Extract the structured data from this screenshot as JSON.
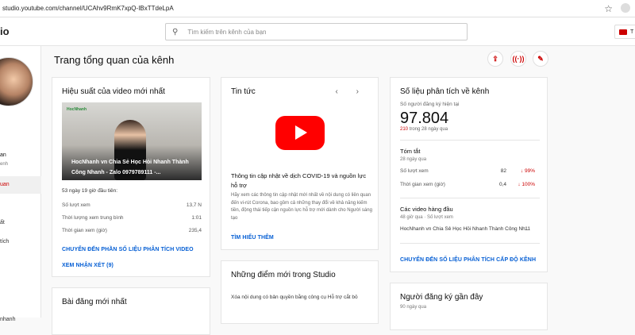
{
  "browser": {
    "url": "studio.youtube.com/channel/UCAhv9RmK7xpQ-IBxTTdeLpA"
  },
  "topbar": {
    "logo": "io",
    "search_placeholder": "Tìm kiếm trên kênh của bạn",
    "create_label": "T"
  },
  "sidebar": {
    "channel_name": "an",
    "channel_sub": "enh",
    "items": [
      {
        "label": "uan"
      },
      {
        "label": "ất"
      },
      {
        "label": "tích"
      },
      {
        "label": "nhanh"
      }
    ]
  },
  "page": {
    "title": "Trang tổng quan của kênh"
  },
  "latest_video": {
    "title": "Hiệu suất của video mới nhất",
    "thumb_brand": "HocNhanh",
    "thumb_caption": "HocNhanh vn Chia Sẻ Học Hỏi Nhanh Thành Công Nhanh - Zalo 0979789111 -...",
    "period": "53 ngày 19 giờ đầu tiên:",
    "stats": [
      {
        "label": "Số lượt xem",
        "value": "13,7 N"
      },
      {
        "label": "Thời lượng xem trung bình",
        "value": "1:01"
      },
      {
        "label": "Thời gian xem (giờ)",
        "value": "235,4"
      }
    ],
    "link_analytics": "CHUYỂN ĐẾN PHẦN SỐ LIỆU PHÂN TÍCH VIDEO",
    "link_comments": "XEM NHẬN XÉT (9)"
  },
  "latest_post": {
    "title": "Bài đăng mới nhất"
  },
  "news": {
    "title": "Tin tức",
    "headline": "Thông tin cập nhật về dịch COVID-19 và nguồn lực hỗ trợ",
    "body": "Hãy xem các thông tin cập nhật mới nhất về nội dung có liên quan đến vi-rút Corona, bao gồm cả những thay đổi về khả năng kiếm tiền, động thái tiếp cận nguồn lực hỗ trợ mới dành cho Người sáng tạo",
    "link": "TÌM HIỂU THÊM",
    "arrows": "‹ ›"
  },
  "whats_new": {
    "title": "Những điểm mới trong Studio",
    "item": "Xóa nội dung có bản quyền bằng công cụ Hỗ trợ cắt bỏ"
  },
  "analytics": {
    "title": "Số liệu phân tích về kênh",
    "subs_label": "Số người đăng ký hiện tại",
    "subs_value": "97.804",
    "subs_change": "210",
    "subs_change_suffix": "trong 28 ngày qua",
    "summary_title": "Tóm tắt",
    "summary_period": "28 ngày qua",
    "metrics": [
      {
        "label": "Số lượt xem",
        "value": "82",
        "delta": "99%"
      },
      {
        "label": "Thời gian xem (giờ)",
        "value": "0,4",
        "delta": "100%"
      }
    ],
    "top_videos_title": "Các video hàng đầu",
    "top_videos_sub": "48 giờ qua · Số lượt xem",
    "top_video": {
      "title": "HocNhanh vn Chia Sẻ Học Hỏi Nhanh Thành Công Nh...",
      "views": "11"
    },
    "link": "CHUYỂN ĐẾN SỐ LIỆU PHÂN TÍCH CẤP ĐỘ KÊNH"
  },
  "recent_subs": {
    "title": "Người đăng ký gần đây",
    "period": "90 ngày qua"
  },
  "colors": {
    "accent": "#cc0000",
    "link": "#065fd4"
  }
}
